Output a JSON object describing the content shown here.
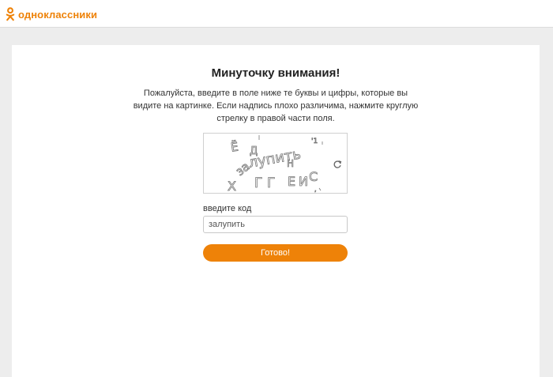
{
  "brand": {
    "name": "одноклассники",
    "color": "#ee8208",
    "icon": "ok-logo-icon"
  },
  "page": {
    "title": "Минуточку внимания!",
    "description": "Пожалуйста, введите в поле ниже те буквы и цифры, которые вы видите на картинке. Если надпись плохо различима, нажмите круглую стрелку в правой части поля."
  },
  "captcha": {
    "refresh_icon": "refresh-icon"
  },
  "form": {
    "code_label": "введите код",
    "code_value": "залупить",
    "submit_label": "Готово!"
  }
}
